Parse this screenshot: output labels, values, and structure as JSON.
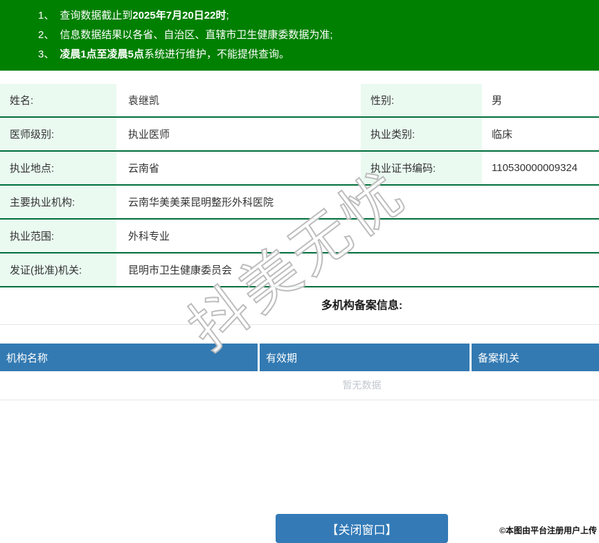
{
  "notice": {
    "items": [
      {
        "num": "1、",
        "pre": "查询数据截止到",
        "bold": "2025年7月20日22时",
        "post": ";"
      },
      {
        "num": "2、",
        "pre": "信息数据结果以各省、自治区、直辖市卫生健康委数据为准;",
        "bold": "",
        "post": ""
      },
      {
        "num": "3、",
        "pre": "",
        "bold": "凌晨1点至凌晨5点",
        "post": "系统进行维护，不能提供查询。"
      }
    ]
  },
  "doctor": {
    "rows": [
      {
        "label": "姓名:",
        "value": "袁继凯",
        "label2": "性别:",
        "value2": "男"
      },
      {
        "label": "医师级别:",
        "value": "执业医师",
        "label2": "执业类别:",
        "value2": "临床"
      },
      {
        "label": "执业地点:",
        "value": "云南省",
        "label2": "执业证书编码:",
        "value2": "110530000009324"
      },
      {
        "label": "主要执业机构:",
        "value": "云南华美美莱昆明整形外科医院"
      },
      {
        "label": "执业范围:",
        "value": "外科专业"
      },
      {
        "label": "发证(批准)机关:",
        "value": "昆明市卫生健康委员会"
      }
    ]
  },
  "records": {
    "section_title": "多机构备案信息:",
    "headers": [
      "机构名称",
      "有效期",
      "备案机关"
    ],
    "empty_text": "暂无数据"
  },
  "footer": {
    "close_label": "【关闭窗口】",
    "credit": "©本图由平台注册用户上传"
  },
  "watermark": {
    "text": "抖美无忧"
  },
  "colors": {
    "banner_green": "#008000",
    "row_divider_green": "#006e3c",
    "label_cell_bg": "#eafaf1",
    "table_header_blue": "#337ab2",
    "button_blue": "#337ab7",
    "empty_text_gray": "#c2c7cf"
  }
}
